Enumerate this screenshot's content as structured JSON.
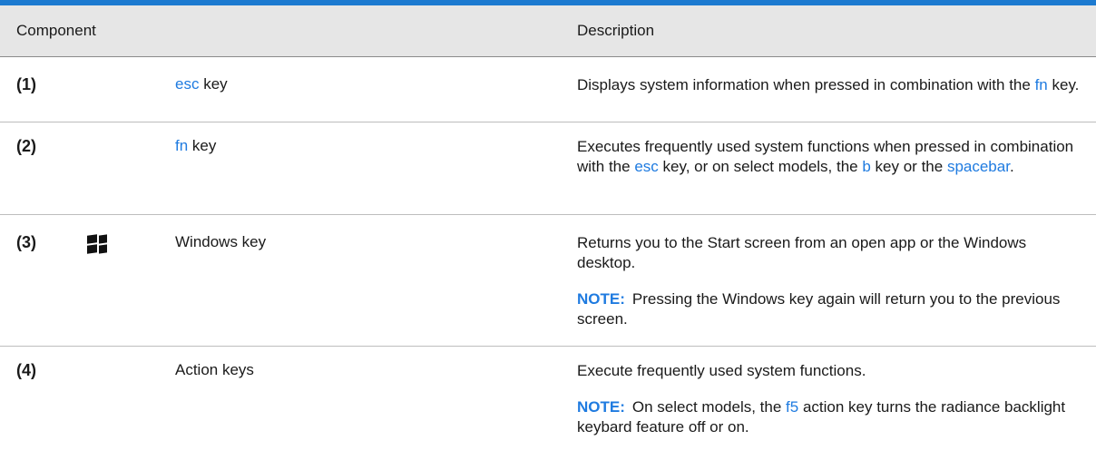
{
  "header": {
    "component": "Component",
    "description": "Description"
  },
  "rows": [
    {
      "num": "(1)",
      "name_kw": "esc",
      "name_rest": " key",
      "desc": {
        "a": "Displays system information when pressed in combination with the ",
        "kw1": "fn",
        "b": " key."
      }
    },
    {
      "num": "(2)",
      "name_kw": "fn",
      "name_rest": " key",
      "desc": {
        "a": "Executes frequently used system functions when pressed in combination with the ",
        "kw1": "esc",
        "b": " key, or on select models, the ",
        "kw2": "b",
        "c": " key or the ",
        "kw3": "spacebar",
        "d": "."
      }
    },
    {
      "num": "(3)",
      "icon": "windows-logo-icon",
      "name": "Windows key",
      "desc": "Returns you to the Start screen from an open app or the Windows desktop.",
      "note_label": "NOTE:",
      "note": "Pressing the Windows key again will return you to the previous screen."
    },
    {
      "num": "(4)",
      "name": "Action keys",
      "desc": "Execute frequently used system functions.",
      "note_label": "NOTE:",
      "note_a": "On select models, the ",
      "note_kw": "f5",
      "note_b": " action key turns the radiance backlight keybard feature off or on."
    }
  ],
  "colors": {
    "accent": "#1c7ad0",
    "keyword": "#1f7be0",
    "header_bg": "#e6e6e6"
  }
}
